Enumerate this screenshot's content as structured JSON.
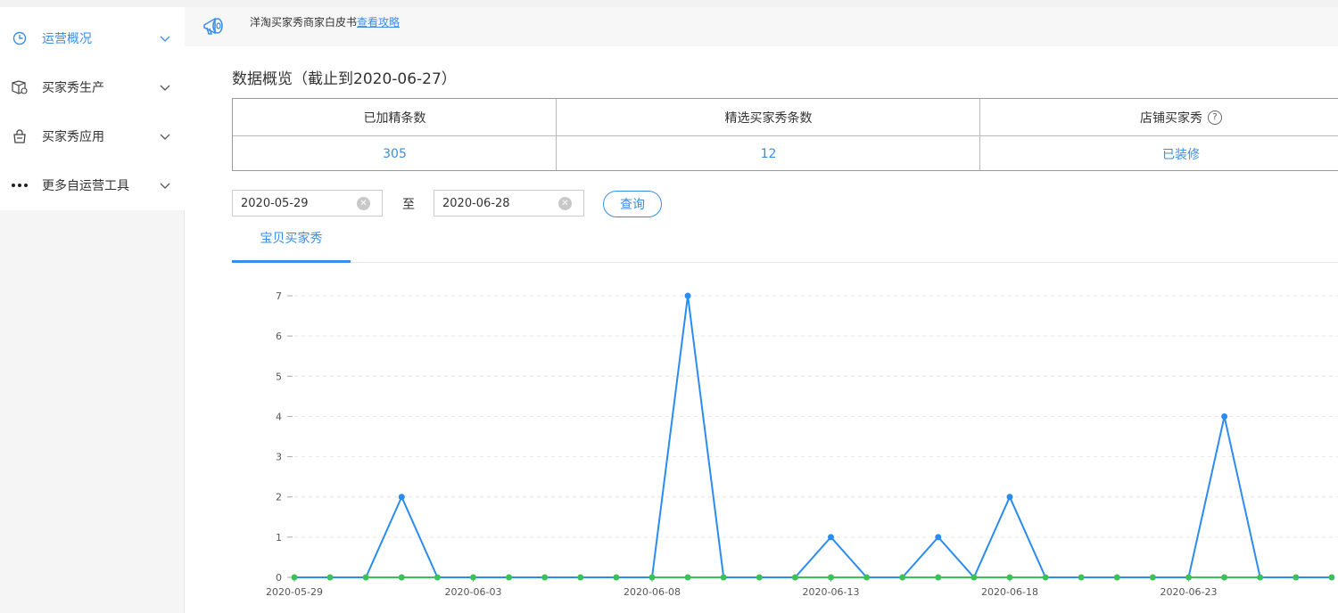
{
  "sidebar": {
    "items": [
      {
        "label": "运营概况",
        "icon": "clock-icon",
        "active": true
      },
      {
        "label": "买家秀生产",
        "icon": "box-icon",
        "active": false
      },
      {
        "label": "买家秀应用",
        "icon": "bag-icon",
        "active": false
      },
      {
        "label": "更多自运营工具",
        "icon": "more-dots-icon",
        "active": false
      }
    ]
  },
  "notice": {
    "icon": "megaphone-icon",
    "text": "洋淘买家秀商家白皮书",
    "link": "查看攻略"
  },
  "overview": {
    "title": "数据概览（截止到2020-06-27）",
    "columns": [
      {
        "header": "已加精条数",
        "value": "305"
      },
      {
        "header": "精选买家秀条数",
        "value": "12"
      },
      {
        "header": "店铺买家秀",
        "value": "已装修",
        "help_icon": "question-circle-icon"
      }
    ]
  },
  "filters": {
    "start_date": "2020-05-29",
    "end_date": "2020-06-28",
    "to_label": "至",
    "query_label": "查询"
  },
  "tabs": [
    {
      "label": "宝贝买家秀",
      "active": true
    }
  ],
  "colors": {
    "accent": "#3a8ee6",
    "series_blue": "#2b8cf0",
    "series_green": "#3cc05a"
  },
  "chart_data": {
    "type": "line",
    "x": [
      "2020-05-29",
      "2020-05-30",
      "2020-05-31",
      "2020-06-01",
      "2020-06-02",
      "2020-06-03",
      "2020-06-04",
      "2020-06-05",
      "2020-06-06",
      "2020-06-07",
      "2020-06-08",
      "2020-06-09",
      "2020-06-10",
      "2020-06-11",
      "2020-06-12",
      "2020-06-13",
      "2020-06-14",
      "2020-06-15",
      "2020-06-16",
      "2020-06-17",
      "2020-06-18",
      "2020-06-19",
      "2020-06-20",
      "2020-06-21",
      "2020-06-22",
      "2020-06-23",
      "2020-06-24",
      "2020-06-25",
      "2020-06-26",
      "2020-06-27"
    ],
    "x_tick_labels": [
      "2020-05-29",
      "2020-06-03",
      "2020-06-08",
      "2020-06-13",
      "2020-06-18",
      "2020-06-23"
    ],
    "ylim": [
      0,
      7
    ],
    "y_ticks": [
      0,
      1,
      2,
      3,
      4,
      5,
      6,
      7
    ],
    "grid": true,
    "series": [
      {
        "color": "#2b8cf0",
        "values": [
          0,
          0,
          0,
          2,
          0,
          0,
          0,
          0,
          0,
          0,
          0,
          7,
          0,
          0,
          0,
          1,
          0,
          0,
          1,
          0,
          2,
          0,
          0,
          0,
          0,
          0,
          4,
          0,
          0,
          0
        ]
      },
      {
        "color": "#3cc05a",
        "values": [
          0,
          0,
          0,
          0,
          0,
          0,
          0,
          0,
          0,
          0,
          0,
          0,
          0,
          0,
          0,
          0,
          0,
          0,
          0,
          0,
          0,
          0,
          0,
          0,
          0,
          0,
          0,
          0,
          0,
          0
        ]
      }
    ]
  }
}
